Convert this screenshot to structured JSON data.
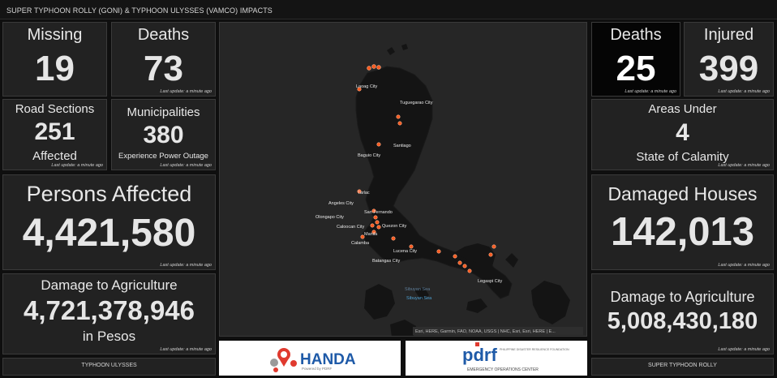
{
  "header": {
    "title": "SUPER TYPHOON ROLLY (GONI) & TYPHOON ULYSSES (VAMCO) IMPACTS"
  },
  "left": {
    "missing": {
      "label": "Missing",
      "value": "19",
      "update": "Last update: a minute ago"
    },
    "deaths": {
      "label": "Deaths",
      "value": "73",
      "update": "Last update: a minute ago"
    },
    "road": {
      "label": "Road Sections",
      "value": "251",
      "sublabel": "Affected",
      "update": "Last update: a minute ago"
    },
    "municipalities": {
      "label": "Municipalities",
      "value": "380",
      "sublabel": "Experience Power Outage",
      "update": "Last update: a minute ago"
    },
    "persons": {
      "label": "Persons Affected",
      "value": "4,421,580",
      "update": "Last update: a minute ago"
    },
    "agri": {
      "label": "Damage to Agriculture",
      "value": "4,721,378,946",
      "sublabel": "in Pesos",
      "update": "Last update: a minute ago"
    },
    "footer": "TYPHOON ULYSSES"
  },
  "right": {
    "deaths": {
      "label": "Deaths",
      "value": "25",
      "update": "Last update: a minute ago"
    },
    "injured": {
      "label": "Injured",
      "value": "399",
      "update": "Last update: a minute ago"
    },
    "areas": {
      "label": "Areas Under",
      "value": "4",
      "sublabel": "State of Calamity",
      "update": "Last update: a minute ago"
    },
    "houses": {
      "label": "Damaged Houses",
      "value": "142,013",
      "update": "Last update: a minute ago"
    },
    "agri": {
      "label": "Damage to Agriculture",
      "value": "5,008,430,180",
      "update": "Last update: a minute ago"
    },
    "footer": "SUPER TYPHOON ROLLY"
  },
  "map": {
    "cities": [
      "Laoag City",
      "Tuguegarao City",
      "Santiago",
      "Baguio City",
      "Tarlac",
      "Angeles City",
      "San Fernando",
      "Olongapo City",
      "Caloocan City",
      "Quezon City",
      "Manila",
      "Calamba",
      "Lucena City",
      "Batangas City",
      "Legaspi City"
    ],
    "seas": [
      "Sibuyan Sea",
      "Sibuyan Sea"
    ],
    "attribution": "Esri, HERE, Garmin, FAO, NOAA, USGS | NHC, Esri, Esri, HERE | E..."
  },
  "logos": {
    "handa": {
      "name": "HANDA",
      "tagline": "Powered by PDRF"
    },
    "pdrf": {
      "name": "pdrf",
      "subtitle": "PHILIPPINE DISASTER RESILIENCE FOUNDATION",
      "caption": "EMERGENCY OPERATIONS CENTER"
    }
  },
  "colors": {
    "background": "#0f0f0f",
    "card": "#222222",
    "highlight_card": "#050505",
    "marker": "#ff5a1f",
    "handa_red": "#e03a2f",
    "pdrf_blue": "#1e5aa8"
  }
}
